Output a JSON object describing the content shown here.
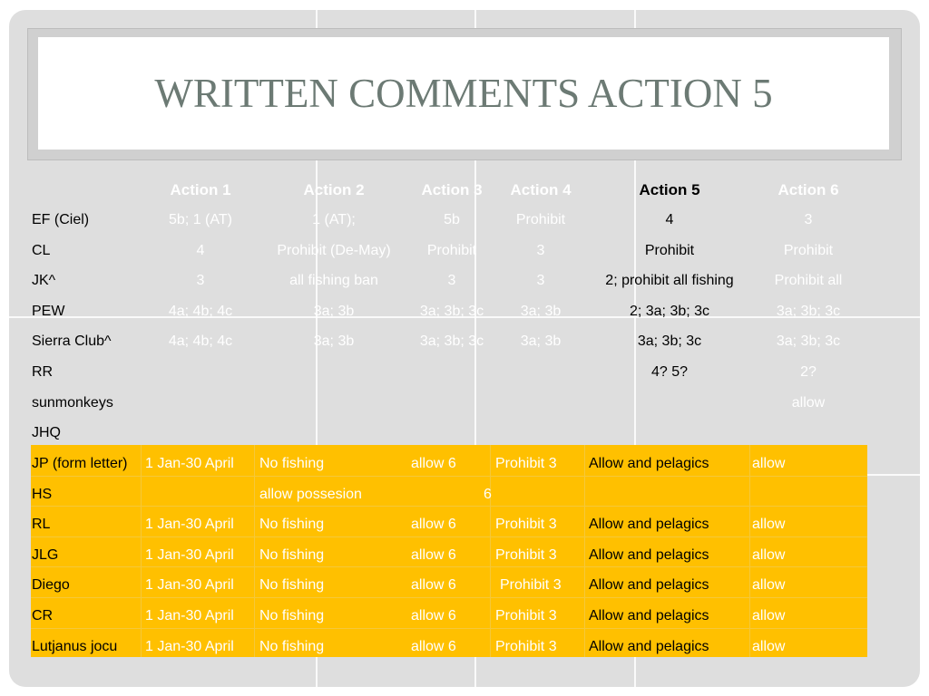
{
  "slide": {
    "title": "WRITTEN COMMENTS ACTION 5",
    "colors": {
      "panel": "#dedede",
      "highlight": "#ffc000",
      "title": "#6c7a74"
    }
  },
  "table": {
    "headers": [
      "",
      "Action 1",
      "Action 2",
      "Action 3",
      "Action 4",
      "Action 5",
      "Action 6"
    ],
    "rows": [
      {
        "name": "EF (Ciel)",
        "a1": "5b; 1 (AT)",
        "a2": "1 (AT);",
        "a3": "5b",
        "a4": "Prohibit",
        "a5": "4",
        "a6": "3"
      },
      {
        "name": "CL",
        "a1": "4",
        "a2": "Prohibit (De-May)",
        "a3": "Prohibit",
        "a4": "3",
        "a5": "Prohibit",
        "a6": "Prohibit"
      },
      {
        "name": "JK^",
        "a1": "3",
        "a2": "all fishing ban",
        "a3": "3",
        "a4": "3",
        "a5": "2; prohibit all fishing",
        "a6": "Prohibit all"
      },
      {
        "name": "PEW",
        "a1": "4a; 4b; 4c",
        "a2": "3a; 3b",
        "a3": "3a; 3b; 3c",
        "a4": "3a; 3b",
        "a5": "2; 3a; 3b; 3c",
        "a6": "3a; 3b; 3c"
      },
      {
        "name": "Sierra Club^",
        "a1": "4a; 4b; 4c",
        "a2": "3a; 3b",
        "a3": "3a; 3b; 3c",
        "a4": "3a; 3b",
        "a5": "3a; 3b; 3c",
        "a6": "3a; 3b; 3c"
      },
      {
        "name": "RR",
        "a1": "",
        "a2": "",
        "a3": "",
        "a4": "",
        "a5": "4? 5?",
        "a6": "2?"
      },
      {
        "name": "sunmonkeys",
        "a1": "",
        "a2": "",
        "a3": "",
        "a4": "",
        "a5": "",
        "a6": "allow"
      },
      {
        "name": "JHQ",
        "a1": "",
        "a2": "",
        "a3": "",
        "a4": "",
        "a5": "",
        "a6": ""
      }
    ],
    "highlighted_rows": [
      {
        "name": "JP (form letter)",
        "a1": "1 Jan-30 April",
        "a2": "No fishing",
        "a3": "allow 6",
        "a4": "Prohibit 3",
        "a5": "Allow and pelagics",
        "a6": "allow"
      },
      {
        "name": "HS",
        "a1": "",
        "a2": "allow possesion",
        "a3": "6",
        "a4": "",
        "a5": "",
        "a6": ""
      },
      {
        "name": "RL",
        "a1": "1 Jan-30 April",
        "a2": "No fishing",
        "a3": "allow 6",
        "a4": "Prohibit 3",
        "a5": "Allow and pelagics",
        "a6": "allow"
      },
      {
        "name": "JLG",
        "a1": "1 Jan-30 April",
        "a2": "No fishing",
        "a3": "allow 6",
        "a4": "Prohibit 3",
        "a5": "Allow and pelagics",
        "a6": "allow"
      },
      {
        "name": "Diego",
        "a1": "1 Jan-30 April",
        "a2": "No fishing",
        "a3": "allow 6",
        "a4": "Prohibit 3",
        "a5": "Allow and pelagics",
        "a6": "allow"
      },
      {
        "name": "CR",
        "a1": "1 Jan-30 April",
        "a2": "No fishing",
        "a3": "allow 6",
        "a4": "Prohibit 3",
        "a5": "Allow and pelagics",
        "a6": "allow"
      },
      {
        "name": "Lutjanus jocu",
        "a1": "1 Jan-30 April",
        "a2": "No fishing",
        "a3": "allow 6",
        "a4": "Prohibit 3",
        "a5": "Allow and pelagics",
        "a6": "allow"
      }
    ]
  }
}
